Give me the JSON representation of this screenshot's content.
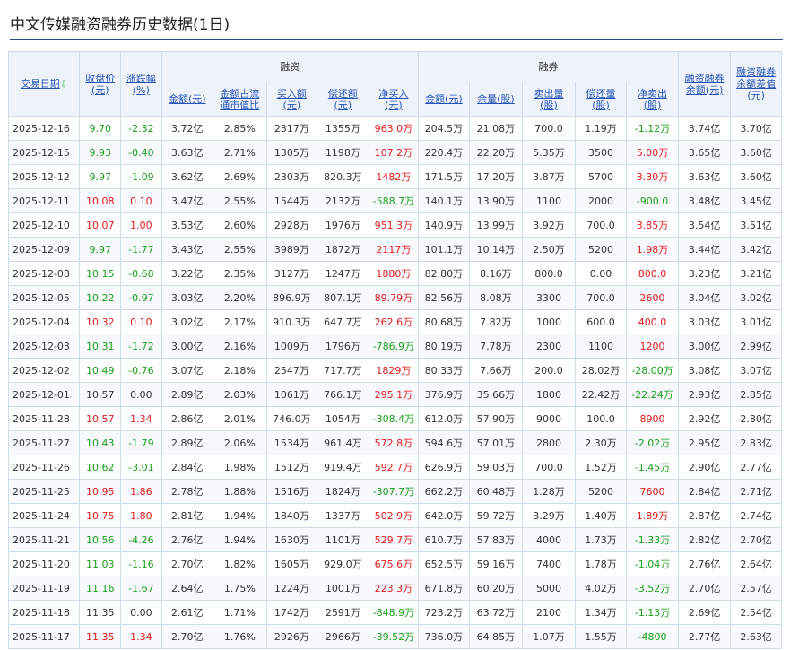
{
  "title": "中文传媒融资融券历史数据(1日)",
  "colors": {
    "up": "#e31a1a",
    "down": "#17a017",
    "header_bg": "#eef3fa",
    "title_rule": "#2b4f8a"
  },
  "headers": {
    "date": "交易日期",
    "date_sort_icon": "arrow-down-icon",
    "close": "收盘价(元)",
    "change": "涨跌幅(%)",
    "rz": "融资",
    "rq": "融券",
    "rz_amount": "金额(元)",
    "rz_ratio": "金额占流通市值比",
    "rz_buy": "买入额(元)",
    "rz_repay": "偿还额(元)",
    "rz_net": "净买入(元)",
    "rq_amount": "金额(元)",
    "rq_qty": "余量(股)",
    "rq_sell": "卖出量(股)",
    "rq_repay": "偿还量(股)",
    "rq_net": "净卖出(股)",
    "total": "融资融券余额(元)",
    "diff": "融资融券余额差值(元)"
  },
  "rows": [
    {
      "date": "2025-12-16",
      "close": "9.70",
      "change": "-2.32",
      "rz_amount": "3.72亿",
      "rz_ratio": "2.85%",
      "rz_buy": "2317万",
      "rz_repay": "1355万",
      "rz_net": "963.0万",
      "rq_amount": "204.5万",
      "rq_qty": "21.08万",
      "rq_sell": "700.0",
      "rq_repay": "1.19万",
      "rq_net": "-1.12万",
      "total": "3.74亿",
      "diff": "3.70亿",
      "c": "down",
      "n": "up",
      "q": "down"
    },
    {
      "date": "2025-12-15",
      "close": "9.93",
      "change": "-0.40",
      "rz_amount": "3.63亿",
      "rz_ratio": "2.71%",
      "rz_buy": "1305万",
      "rz_repay": "1198万",
      "rz_net": "107.2万",
      "rq_amount": "220.4万",
      "rq_qty": "22.20万",
      "rq_sell": "5.35万",
      "rq_repay": "3500",
      "rq_net": "5.00万",
      "total": "3.65亿",
      "diff": "3.60亿",
      "c": "down",
      "n": "up",
      "q": "up"
    },
    {
      "date": "2025-12-12",
      "close": "9.97",
      "change": "-1.09",
      "rz_amount": "3.62亿",
      "rz_ratio": "2.69%",
      "rz_buy": "2303万",
      "rz_repay": "820.3万",
      "rz_net": "1482万",
      "rq_amount": "171.5万",
      "rq_qty": "17.20万",
      "rq_sell": "3.87万",
      "rq_repay": "5700",
      "rq_net": "3.30万",
      "total": "3.63亿",
      "diff": "3.60亿",
      "c": "down",
      "n": "up",
      "q": "up"
    },
    {
      "date": "2025-12-11",
      "close": "10.08",
      "change": "0.10",
      "rz_amount": "3.47亿",
      "rz_ratio": "2.55%",
      "rz_buy": "1544万",
      "rz_repay": "2132万",
      "rz_net": "-588.7万",
      "rq_amount": "140.1万",
      "rq_qty": "13.90万",
      "rq_sell": "1100",
      "rq_repay": "2000",
      "rq_net": "-900.0",
      "total": "3.48亿",
      "diff": "3.45亿",
      "c": "up",
      "n": "down",
      "q": "down"
    },
    {
      "date": "2025-12-10",
      "close": "10.07",
      "change": "1.00",
      "rz_amount": "3.53亿",
      "rz_ratio": "2.60%",
      "rz_buy": "2928万",
      "rz_repay": "1976万",
      "rz_net": "951.3万",
      "rq_amount": "140.9万",
      "rq_qty": "13.99万",
      "rq_sell": "3.92万",
      "rq_repay": "700.0",
      "rq_net": "3.85万",
      "total": "3.54亿",
      "diff": "3.51亿",
      "c": "up",
      "n": "up",
      "q": "up"
    },
    {
      "date": "2025-12-09",
      "close": "9.97",
      "change": "-1.77",
      "rz_amount": "3.43亿",
      "rz_ratio": "2.55%",
      "rz_buy": "3989万",
      "rz_repay": "1872万",
      "rz_net": "2117万",
      "rq_amount": "101.1万",
      "rq_qty": "10.14万",
      "rq_sell": "2.50万",
      "rq_repay": "5200",
      "rq_net": "1.98万",
      "total": "3.44亿",
      "diff": "3.42亿",
      "c": "down",
      "n": "up",
      "q": "up"
    },
    {
      "date": "2025-12-08",
      "close": "10.15",
      "change": "-0.68",
      "rz_amount": "3.22亿",
      "rz_ratio": "2.35%",
      "rz_buy": "3127万",
      "rz_repay": "1247万",
      "rz_net": "1880万",
      "rq_amount": "82.80万",
      "rq_qty": "8.16万",
      "rq_sell": "800.0",
      "rq_repay": "0.00",
      "rq_net": "800.0",
      "total": "3.23亿",
      "diff": "3.21亿",
      "c": "down",
      "n": "up",
      "q": "up"
    },
    {
      "date": "2025-12-05",
      "close": "10.22",
      "change": "-0.97",
      "rz_amount": "3.03亿",
      "rz_ratio": "2.20%",
      "rz_buy": "896.9万",
      "rz_repay": "807.1万",
      "rz_net": "89.79万",
      "rq_amount": "82.56万",
      "rq_qty": "8.08万",
      "rq_sell": "3300",
      "rq_repay": "700.0",
      "rq_net": "2600",
      "total": "3.04亿",
      "diff": "3.02亿",
      "c": "down",
      "n": "up",
      "q": "up"
    },
    {
      "date": "2025-12-04",
      "close": "10.32",
      "change": "0.10",
      "rz_amount": "3.02亿",
      "rz_ratio": "2.17%",
      "rz_buy": "910.3万",
      "rz_repay": "647.7万",
      "rz_net": "262.6万",
      "rq_amount": "80.68万",
      "rq_qty": "7.82万",
      "rq_sell": "1000",
      "rq_repay": "600.0",
      "rq_net": "400.0",
      "total": "3.03亿",
      "diff": "3.01亿",
      "c": "up",
      "n": "up",
      "q": "up"
    },
    {
      "date": "2025-12-03",
      "close": "10.31",
      "change": "-1.72",
      "rz_amount": "3.00亿",
      "rz_ratio": "2.16%",
      "rz_buy": "1009万",
      "rz_repay": "1796万",
      "rz_net": "-786.9万",
      "rq_amount": "80.19万",
      "rq_qty": "7.78万",
      "rq_sell": "2300",
      "rq_repay": "1100",
      "rq_net": "1200",
      "total": "3.00亿",
      "diff": "2.99亿",
      "c": "down",
      "n": "down",
      "q": "up"
    },
    {
      "date": "2025-12-02",
      "close": "10.49",
      "change": "-0.76",
      "rz_amount": "3.07亿",
      "rz_ratio": "2.18%",
      "rz_buy": "2547万",
      "rz_repay": "717.7万",
      "rz_net": "1829万",
      "rq_amount": "80.33万",
      "rq_qty": "7.66万",
      "rq_sell": "200.0",
      "rq_repay": "28.02万",
      "rq_net": "-28.00万",
      "total": "3.08亿",
      "diff": "3.07亿",
      "c": "down",
      "n": "up",
      "q": "down"
    },
    {
      "date": "2025-12-01",
      "close": "10.57",
      "change": "0.00",
      "rz_amount": "2.89亿",
      "rz_ratio": "2.03%",
      "rz_buy": "1061万",
      "rz_repay": "766.1万",
      "rz_net": "295.1万",
      "rq_amount": "376.9万",
      "rq_qty": "35.66万",
      "rq_sell": "1800",
      "rq_repay": "22.42万",
      "rq_net": "-22.24万",
      "total": "2.93亿",
      "diff": "2.85亿",
      "c": "flat",
      "n": "up",
      "q": "down"
    },
    {
      "date": "2025-11-28",
      "close": "10.57",
      "change": "1.34",
      "rz_amount": "2.86亿",
      "rz_ratio": "2.01%",
      "rz_buy": "746.0万",
      "rz_repay": "1054万",
      "rz_net": "-308.4万",
      "rq_amount": "612.0万",
      "rq_qty": "57.90万",
      "rq_sell": "9000",
      "rq_repay": "100.0",
      "rq_net": "8900",
      "total": "2.92亿",
      "diff": "2.80亿",
      "c": "up",
      "n": "down",
      "q": "up"
    },
    {
      "date": "2025-11-27",
      "close": "10.43",
      "change": "-1.79",
      "rz_amount": "2.89亿",
      "rz_ratio": "2.06%",
      "rz_buy": "1534万",
      "rz_repay": "961.4万",
      "rz_net": "572.8万",
      "rq_amount": "594.6万",
      "rq_qty": "57.01万",
      "rq_sell": "2800",
      "rq_repay": "2.30万",
      "rq_net": "-2.02万",
      "total": "2.95亿",
      "diff": "2.83亿",
      "c": "down",
      "n": "up",
      "q": "down"
    },
    {
      "date": "2025-11-26",
      "close": "10.62",
      "change": "-3.01",
      "rz_amount": "2.84亿",
      "rz_ratio": "1.98%",
      "rz_buy": "1512万",
      "rz_repay": "919.4万",
      "rz_net": "592.7万",
      "rq_amount": "626.9万",
      "rq_qty": "59.03万",
      "rq_sell": "700.0",
      "rq_repay": "1.52万",
      "rq_net": "-1.45万",
      "total": "2.90亿",
      "diff": "2.77亿",
      "c": "down",
      "n": "up",
      "q": "down"
    },
    {
      "date": "2025-11-25",
      "close": "10.95",
      "change": "1.86",
      "rz_amount": "2.78亿",
      "rz_ratio": "1.88%",
      "rz_buy": "1516万",
      "rz_repay": "1824万",
      "rz_net": "-307.7万",
      "rq_amount": "662.2万",
      "rq_qty": "60.48万",
      "rq_sell": "1.28万",
      "rq_repay": "5200",
      "rq_net": "7600",
      "total": "2.84亿",
      "diff": "2.71亿",
      "c": "up",
      "n": "down",
      "q": "up"
    },
    {
      "date": "2025-11-24",
      "close": "10.75",
      "change": "1.80",
      "rz_amount": "2.81亿",
      "rz_ratio": "1.94%",
      "rz_buy": "1840万",
      "rz_repay": "1337万",
      "rz_net": "502.9万",
      "rq_amount": "642.0万",
      "rq_qty": "59.72万",
      "rq_sell": "3.29万",
      "rq_repay": "1.40万",
      "rq_net": "1.89万",
      "total": "2.87亿",
      "diff": "2.74亿",
      "c": "up",
      "n": "up",
      "q": "up"
    },
    {
      "date": "2025-11-21",
      "close": "10.56",
      "change": "-4.26",
      "rz_amount": "2.76亿",
      "rz_ratio": "1.94%",
      "rz_buy": "1630万",
      "rz_repay": "1101万",
      "rz_net": "529.7万",
      "rq_amount": "610.7万",
      "rq_qty": "57.83万",
      "rq_sell": "4000",
      "rq_repay": "1.73万",
      "rq_net": "-1.33万",
      "total": "2.82亿",
      "diff": "2.70亿",
      "c": "down",
      "n": "up",
      "q": "down"
    },
    {
      "date": "2025-11-20",
      "close": "11.03",
      "change": "-1.16",
      "rz_amount": "2.70亿",
      "rz_ratio": "1.82%",
      "rz_buy": "1605万",
      "rz_repay": "929.0万",
      "rz_net": "675.6万",
      "rq_amount": "652.5万",
      "rq_qty": "59.16万",
      "rq_sell": "7400",
      "rq_repay": "1.78万",
      "rq_net": "-1.04万",
      "total": "2.76亿",
      "diff": "2.64亿",
      "c": "down",
      "n": "up",
      "q": "down"
    },
    {
      "date": "2025-11-19",
      "close": "11.16",
      "change": "-1.67",
      "rz_amount": "2.64亿",
      "rz_ratio": "1.75%",
      "rz_buy": "1224万",
      "rz_repay": "1001万",
      "rz_net": "223.3万",
      "rq_amount": "671.8万",
      "rq_qty": "60.20万",
      "rq_sell": "5000",
      "rq_repay": "4.02万",
      "rq_net": "-3.52万",
      "total": "2.70亿",
      "diff": "2.57亿",
      "c": "down",
      "n": "up",
      "q": "down"
    },
    {
      "date": "2025-11-18",
      "close": "11.35",
      "change": "0.00",
      "rz_amount": "2.61亿",
      "rz_ratio": "1.71%",
      "rz_buy": "1742万",
      "rz_repay": "2591万",
      "rz_net": "-848.9万",
      "rq_amount": "723.2万",
      "rq_qty": "63.72万",
      "rq_sell": "2100",
      "rq_repay": "1.34万",
      "rq_net": "-1.13万",
      "total": "2.69亿",
      "diff": "2.54亿",
      "c": "flat",
      "n": "down",
      "q": "down"
    },
    {
      "date": "2025-11-17",
      "close": "11.35",
      "change": "1.34",
      "rz_amount": "2.70亿",
      "rz_ratio": "1.76%",
      "rz_buy": "2926万",
      "rz_repay": "2966万",
      "rz_net": "-39.52万",
      "rq_amount": "736.0万",
      "rq_qty": "64.85万",
      "rq_sell": "1.07万",
      "rq_repay": "1.55万",
      "rq_net": "-4800",
      "total": "2.77亿",
      "diff": "2.63亿",
      "c": "up",
      "n": "down",
      "q": "down"
    }
  ]
}
